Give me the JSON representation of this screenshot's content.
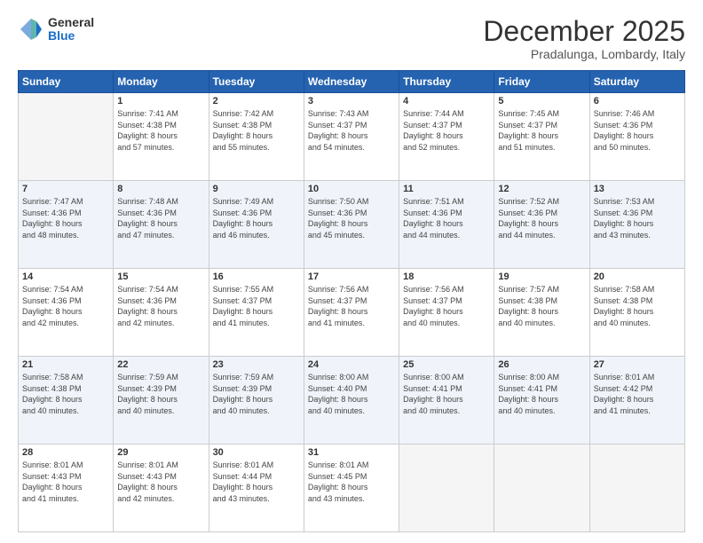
{
  "logo": {
    "general": "General",
    "blue": "Blue"
  },
  "header": {
    "month": "December 2025",
    "location": "Pradalunga, Lombardy, Italy"
  },
  "weekdays": [
    "Sunday",
    "Monday",
    "Tuesday",
    "Wednesday",
    "Thursday",
    "Friday",
    "Saturday"
  ],
  "weeks": [
    [
      {
        "day": "",
        "info": ""
      },
      {
        "day": "1",
        "info": "Sunrise: 7:41 AM\nSunset: 4:38 PM\nDaylight: 8 hours\nand 57 minutes."
      },
      {
        "day": "2",
        "info": "Sunrise: 7:42 AM\nSunset: 4:38 PM\nDaylight: 8 hours\nand 55 minutes."
      },
      {
        "day": "3",
        "info": "Sunrise: 7:43 AM\nSunset: 4:37 PM\nDaylight: 8 hours\nand 54 minutes."
      },
      {
        "day": "4",
        "info": "Sunrise: 7:44 AM\nSunset: 4:37 PM\nDaylight: 8 hours\nand 52 minutes."
      },
      {
        "day": "5",
        "info": "Sunrise: 7:45 AM\nSunset: 4:37 PM\nDaylight: 8 hours\nand 51 minutes."
      },
      {
        "day": "6",
        "info": "Sunrise: 7:46 AM\nSunset: 4:36 PM\nDaylight: 8 hours\nand 50 minutes."
      }
    ],
    [
      {
        "day": "7",
        "info": "Sunrise: 7:47 AM\nSunset: 4:36 PM\nDaylight: 8 hours\nand 48 minutes."
      },
      {
        "day": "8",
        "info": "Sunrise: 7:48 AM\nSunset: 4:36 PM\nDaylight: 8 hours\nand 47 minutes."
      },
      {
        "day": "9",
        "info": "Sunrise: 7:49 AM\nSunset: 4:36 PM\nDaylight: 8 hours\nand 46 minutes."
      },
      {
        "day": "10",
        "info": "Sunrise: 7:50 AM\nSunset: 4:36 PM\nDaylight: 8 hours\nand 45 minutes."
      },
      {
        "day": "11",
        "info": "Sunrise: 7:51 AM\nSunset: 4:36 PM\nDaylight: 8 hours\nand 44 minutes."
      },
      {
        "day": "12",
        "info": "Sunrise: 7:52 AM\nSunset: 4:36 PM\nDaylight: 8 hours\nand 44 minutes."
      },
      {
        "day": "13",
        "info": "Sunrise: 7:53 AM\nSunset: 4:36 PM\nDaylight: 8 hours\nand 43 minutes."
      }
    ],
    [
      {
        "day": "14",
        "info": "Sunrise: 7:54 AM\nSunset: 4:36 PM\nDaylight: 8 hours\nand 42 minutes."
      },
      {
        "day": "15",
        "info": "Sunrise: 7:54 AM\nSunset: 4:36 PM\nDaylight: 8 hours\nand 42 minutes."
      },
      {
        "day": "16",
        "info": "Sunrise: 7:55 AM\nSunset: 4:37 PM\nDaylight: 8 hours\nand 41 minutes."
      },
      {
        "day": "17",
        "info": "Sunrise: 7:56 AM\nSunset: 4:37 PM\nDaylight: 8 hours\nand 41 minutes."
      },
      {
        "day": "18",
        "info": "Sunrise: 7:56 AM\nSunset: 4:37 PM\nDaylight: 8 hours\nand 40 minutes."
      },
      {
        "day": "19",
        "info": "Sunrise: 7:57 AM\nSunset: 4:38 PM\nDaylight: 8 hours\nand 40 minutes."
      },
      {
        "day": "20",
        "info": "Sunrise: 7:58 AM\nSunset: 4:38 PM\nDaylight: 8 hours\nand 40 minutes."
      }
    ],
    [
      {
        "day": "21",
        "info": "Sunrise: 7:58 AM\nSunset: 4:38 PM\nDaylight: 8 hours\nand 40 minutes."
      },
      {
        "day": "22",
        "info": "Sunrise: 7:59 AM\nSunset: 4:39 PM\nDaylight: 8 hours\nand 40 minutes."
      },
      {
        "day": "23",
        "info": "Sunrise: 7:59 AM\nSunset: 4:39 PM\nDaylight: 8 hours\nand 40 minutes."
      },
      {
        "day": "24",
        "info": "Sunrise: 8:00 AM\nSunset: 4:40 PM\nDaylight: 8 hours\nand 40 minutes."
      },
      {
        "day": "25",
        "info": "Sunrise: 8:00 AM\nSunset: 4:41 PM\nDaylight: 8 hours\nand 40 minutes."
      },
      {
        "day": "26",
        "info": "Sunrise: 8:00 AM\nSunset: 4:41 PM\nDaylight: 8 hours\nand 40 minutes."
      },
      {
        "day": "27",
        "info": "Sunrise: 8:01 AM\nSunset: 4:42 PM\nDaylight: 8 hours\nand 41 minutes."
      }
    ],
    [
      {
        "day": "28",
        "info": "Sunrise: 8:01 AM\nSunset: 4:43 PM\nDaylight: 8 hours\nand 41 minutes."
      },
      {
        "day": "29",
        "info": "Sunrise: 8:01 AM\nSunset: 4:43 PM\nDaylight: 8 hours\nand 42 minutes."
      },
      {
        "day": "30",
        "info": "Sunrise: 8:01 AM\nSunset: 4:44 PM\nDaylight: 8 hours\nand 43 minutes."
      },
      {
        "day": "31",
        "info": "Sunrise: 8:01 AM\nSunset: 4:45 PM\nDaylight: 8 hours\nand 43 minutes."
      },
      {
        "day": "",
        "info": ""
      },
      {
        "day": "",
        "info": ""
      },
      {
        "day": "",
        "info": ""
      }
    ]
  ]
}
